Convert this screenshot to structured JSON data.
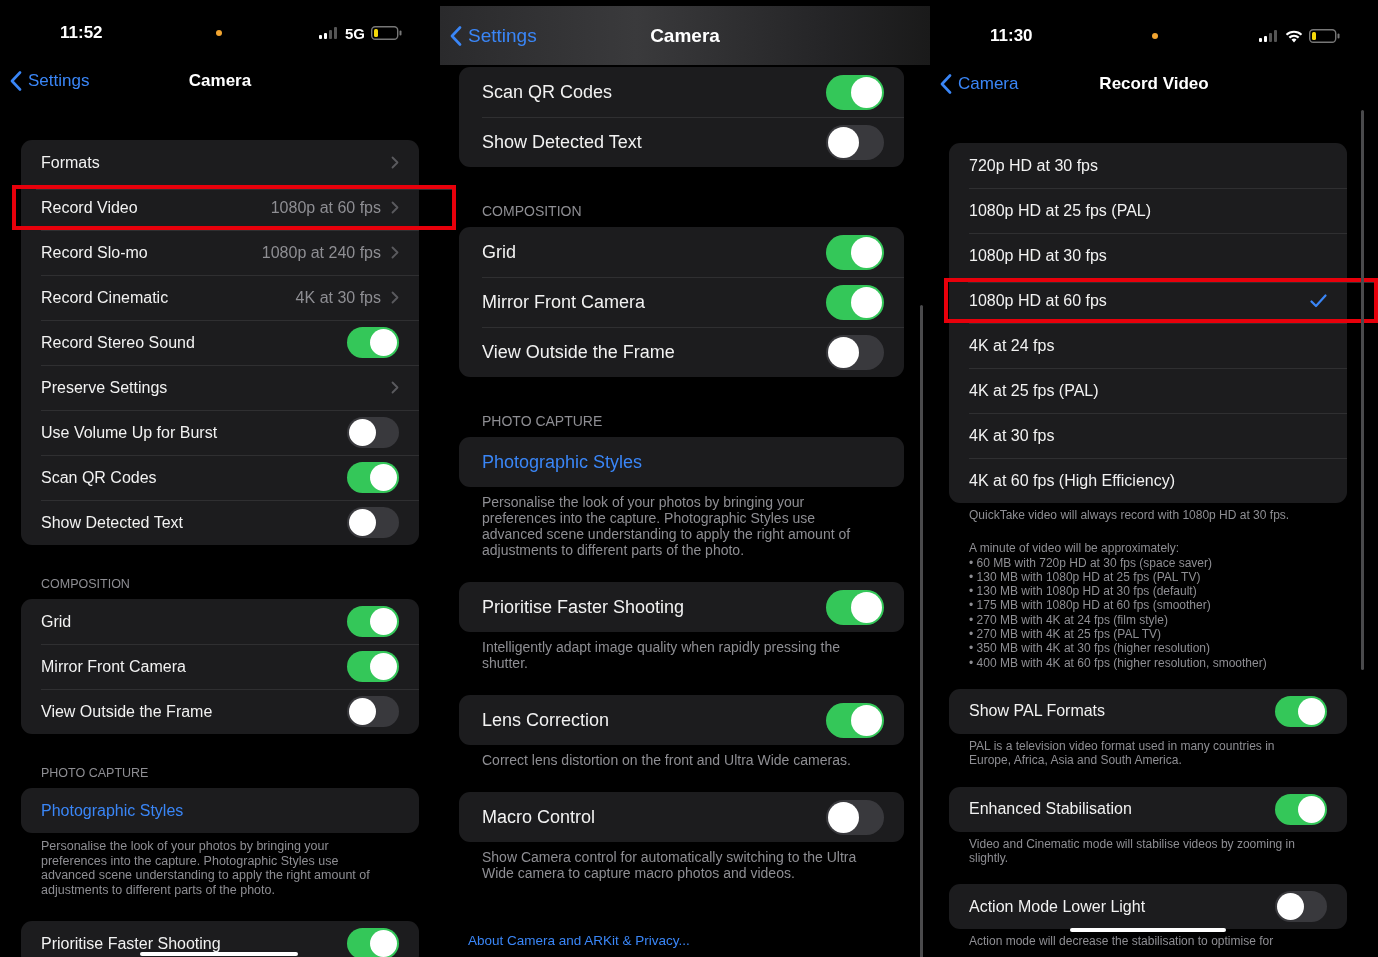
{
  "panels": [
    {
      "status_bar": {
        "time": "11:52",
        "network": "5G"
      },
      "nav": {
        "back": "Settings",
        "title": "Camera"
      },
      "blocks": [
        {
          "kind": "group",
          "rows": [
            {
              "kind": "disclosure",
              "label": "Formats",
              "highlighted": false
            },
            {
              "kind": "disclosure",
              "label": "Record Video",
              "value": "1080p at 60 fps",
              "highlighted": true
            },
            {
              "kind": "disclosure",
              "label": "Record Slo-mo",
              "value": "1080p at 240 fps",
              "highlighted": false
            },
            {
              "kind": "disclosure",
              "label": "Record Cinematic",
              "value": "4K at 30 fps",
              "highlighted": false
            },
            {
              "kind": "toggle",
              "label": "Record Stereo Sound",
              "on": true,
              "highlighted": false
            },
            {
              "kind": "disclosure",
              "label": "Preserve Settings",
              "highlighted": false
            },
            {
              "kind": "toggle",
              "label": "Use Volume Up for Burst",
              "on": false,
              "highlighted": false
            },
            {
              "kind": "toggle",
              "label": "Scan QR Codes",
              "on": true,
              "highlighted": false
            },
            {
              "kind": "toggle",
              "label": "Show Detected Text",
              "on": false,
              "highlighted": false
            }
          ]
        },
        {
          "kind": "header",
          "text": "COMPOSITION"
        },
        {
          "kind": "group",
          "rows": [
            {
              "kind": "toggle",
              "label": "Grid",
              "on": true
            },
            {
              "kind": "toggle",
              "label": "Mirror Front Camera",
              "on": true
            },
            {
              "kind": "toggle",
              "label": "View Outside the Frame",
              "on": false
            }
          ]
        },
        {
          "kind": "header",
          "text": "PHOTO CAPTURE"
        },
        {
          "kind": "group",
          "rows": [
            {
              "kind": "link",
              "label": "Photographic Styles"
            }
          ]
        },
        {
          "kind": "footer",
          "text": "Personalise the look of your photos by bringing your preferences into the capture. Photographic Styles use advanced scene understanding to apply the right amount of adjustments to different parts of the photo."
        },
        {
          "kind": "group",
          "rows": [
            {
              "kind": "toggle",
              "label": "Prioritise Faster Shooting",
              "on": true
            }
          ]
        }
      ]
    },
    {
      "nav": {
        "back": "Settings",
        "title": "Camera"
      },
      "blocks": [
        {
          "kind": "group",
          "rows": [
            {
              "kind": "toggle",
              "label": "Scan QR Codes",
              "on": true
            },
            {
              "kind": "toggle",
              "label": "Show Detected Text",
              "on": false
            }
          ]
        },
        {
          "kind": "header",
          "text": "COMPOSITION"
        },
        {
          "kind": "group",
          "rows": [
            {
              "kind": "toggle",
              "label": "Grid",
              "on": true
            },
            {
              "kind": "toggle",
              "label": "Mirror Front Camera",
              "on": true
            },
            {
              "kind": "toggle",
              "label": "View Outside the Frame",
              "on": false
            }
          ]
        },
        {
          "kind": "header",
          "text": "PHOTO CAPTURE"
        },
        {
          "kind": "group",
          "rows": [
            {
              "kind": "link",
              "label": "Photographic Styles"
            }
          ]
        },
        {
          "kind": "footer",
          "text": "Personalise the look of your photos by bringing your preferences into the capture. Photographic Styles use advanced scene understanding to apply the right amount of adjustments to different parts of the photo."
        },
        {
          "kind": "group",
          "rows": [
            {
              "kind": "toggle",
              "label": "Prioritise Faster Shooting",
              "on": true
            }
          ]
        },
        {
          "kind": "footer",
          "text": "Intelligently adapt image quality when rapidly pressing the shutter."
        },
        {
          "kind": "group",
          "rows": [
            {
              "kind": "toggle",
              "label": "Lens Correction",
              "on": true
            }
          ]
        },
        {
          "kind": "footer",
          "text": "Correct lens distortion on the front and Ultra Wide cameras."
        },
        {
          "kind": "group",
          "rows": [
            {
              "kind": "toggle",
              "label": "Macro Control",
              "on": false
            }
          ]
        },
        {
          "kind": "footer",
          "text": "Show Camera control for automatically switching to the Ultra Wide camera to capture macro photos and videos."
        },
        {
          "kind": "link",
          "text": "About Camera and ARKit & Privacy..."
        }
      ]
    },
    {
      "status_bar": {
        "time": "11:30"
      },
      "nav": {
        "back": "Camera",
        "title": "Record Video"
      },
      "blocks": [
        {
          "kind": "group",
          "rows": [
            {
              "kind": "option",
              "label": "720p HD at 30 fps",
              "selected": false,
              "highlighted": false
            },
            {
              "kind": "option",
              "label": "1080p HD at 25 fps (PAL)",
              "selected": false,
              "highlighted": false
            },
            {
              "kind": "option",
              "label": "1080p HD at 30 fps",
              "selected": false,
              "highlighted": false
            },
            {
              "kind": "option",
              "label": "1080p HD at 60 fps",
              "selected": true,
              "highlighted": true
            },
            {
              "kind": "option",
              "label": "4K at 24 fps",
              "selected": false,
              "highlighted": false
            },
            {
              "kind": "option",
              "label": "4K at 25 fps (PAL)",
              "selected": false,
              "highlighted": false
            },
            {
              "kind": "option",
              "label": "4K at 30 fps",
              "selected": false,
              "highlighted": false
            },
            {
              "kind": "option",
              "label": "4K at 60 fps (High Efficiency)",
              "selected": false,
              "highlighted": false
            }
          ]
        },
        {
          "kind": "footer",
          "text": "QuickTake video will always record with 1080p HD at 30 fps."
        },
        {
          "kind": "footer",
          "lines": [
            "A minute of video will be approximately:",
            "• 60 MB with 720p HD at 30 fps (space saver)",
            "• 130 MB with 1080p HD at 25 fps (PAL TV)",
            "• 130 MB with 1080p HD at 30 fps (default)",
            "• 175 MB with 1080p HD at 60 fps (smoother)",
            "• 270 MB with 4K at 24 fps (film style)",
            "• 270 MB with 4K at 25 fps (PAL TV)",
            "• 350 MB with 4K at 30 fps (higher resolution)",
            "• 400 MB with 4K at 60 fps (higher resolution, smoother)"
          ]
        },
        {
          "kind": "group",
          "rows": [
            {
              "kind": "toggle",
              "label": "Show PAL Formats",
              "on": true
            }
          ]
        },
        {
          "kind": "footer",
          "text": "PAL is a television video format used in many countries in Europe, Africa, Asia and South America."
        },
        {
          "kind": "group",
          "rows": [
            {
              "kind": "toggle",
              "label": "Enhanced Stabilisation",
              "on": true
            }
          ]
        },
        {
          "kind": "footer",
          "text": "Video and Cinematic mode will stabilise videos by zooming in slightly."
        },
        {
          "kind": "group",
          "rows": [
            {
              "kind": "toggle",
              "label": "Action Mode Lower Light",
              "on": false
            }
          ]
        },
        {
          "kind": "footer",
          "text": "Action mode will decrease the stabilisation to optimise for"
        }
      ]
    }
  ]
}
